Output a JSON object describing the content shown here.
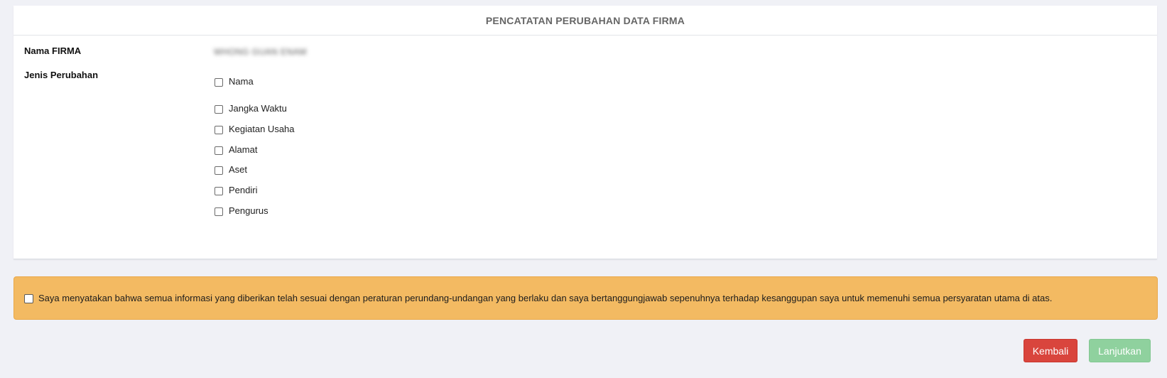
{
  "form": {
    "title": "PENCATATAN PERUBAHAN DATA FIRMA",
    "nama_firma_label": "Nama FIRMA",
    "nama_firma_value": "WHONG GUAN ENAM",
    "jenis_perubahan_label": "Jenis Perubahan",
    "options": [
      {
        "label": "Nama",
        "checked": false
      },
      {
        "label": "Jangka Waktu",
        "checked": false
      },
      {
        "label": "Kegiatan Usaha",
        "checked": false
      },
      {
        "label": "Alamat",
        "checked": false
      },
      {
        "label": "Aset",
        "checked": false
      },
      {
        "label": "Pendiri",
        "checked": false
      },
      {
        "label": "Pengurus",
        "checked": false
      }
    ]
  },
  "declaration": {
    "text": "Saya menyatakan bahwa semua informasi yang diberikan telah sesuai dengan peraturan perundang-undangan yang berlaku dan saya bertanggungjawab sepenuhnya terhadap kesanggupan saya untuk memenuhi semua persyaratan utama di atas.",
    "checked": false,
    "background_color": "#f3ba62"
  },
  "buttons": {
    "back_label": "Kembali",
    "back_color": "#d9453d",
    "next_label": "Lanjutkan",
    "next_color": "#8fd19e",
    "next_enabled": false
  }
}
